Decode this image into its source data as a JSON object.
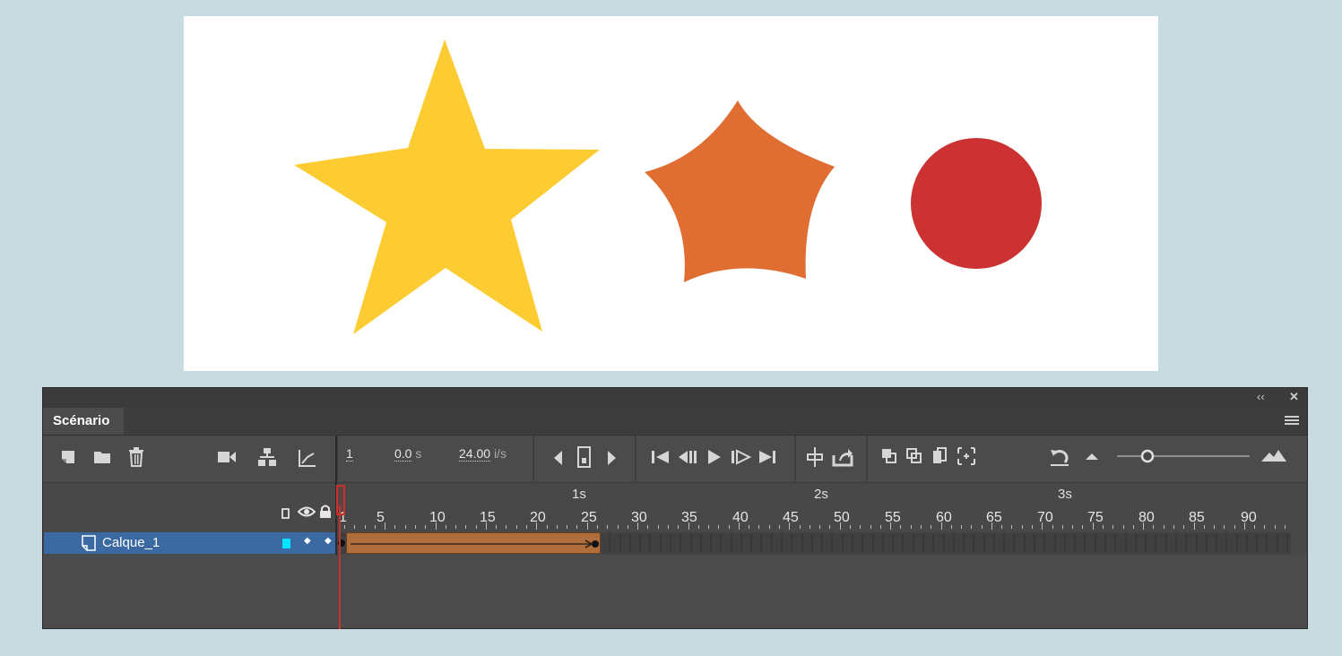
{
  "stage": {
    "shapes": [
      {
        "name": "star-yellow",
        "color": "#fdcc33"
      },
      {
        "name": "star-orange",
        "color": "#e06d32"
      },
      {
        "name": "circle-red",
        "color": "#cc3232"
      }
    ]
  },
  "panel": {
    "tab_label": "Scénario",
    "current_frame": "1",
    "time_value": "0.0",
    "time_unit": "s",
    "fps_value": "24.00",
    "fps_unit": "i/s"
  },
  "ruler": {
    "seconds": [
      "1s",
      "2s",
      "3s"
    ],
    "frame_numbers": [
      "1",
      "5",
      "10",
      "15",
      "20",
      "25",
      "30",
      "35",
      "40",
      "45",
      "50",
      "55",
      "60",
      "65",
      "70",
      "75",
      "80",
      "85",
      "90"
    ]
  },
  "layers": [
    {
      "name": "Calque_1",
      "color": "#00e5ff",
      "tween_start_frame": 1,
      "tween_end_frame": 25
    }
  ],
  "colors": {
    "panel_bg": "#484848",
    "layer_selected": "#3b6aa2",
    "tween": "#b06e3c",
    "playhead": "#c8322e"
  }
}
